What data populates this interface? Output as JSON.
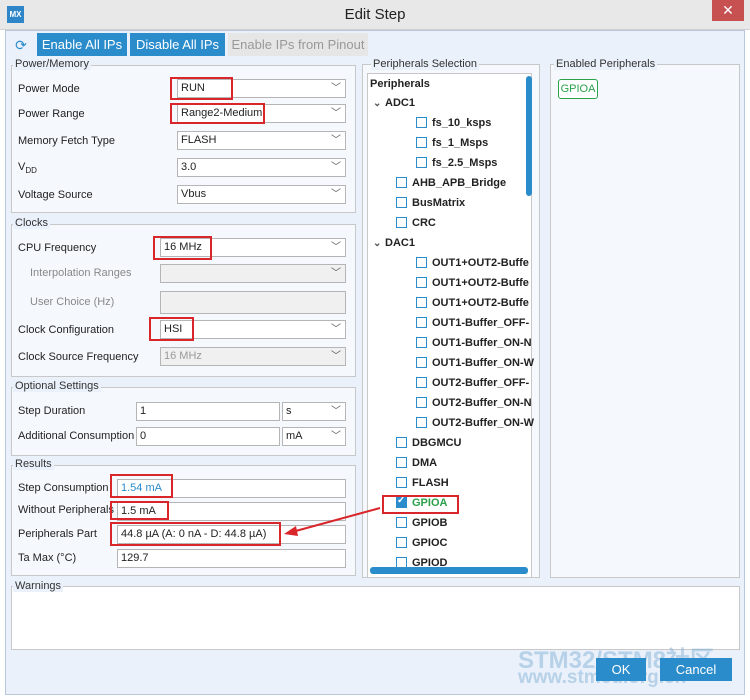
{
  "window": {
    "title": "Edit Step",
    "app_icon": "MX",
    "close_glyph": "✕"
  },
  "toolbar": {
    "refresh_icon": "refresh-icon",
    "enable_all": "Enable All IPs",
    "disable_all": "Disable All IPs",
    "enable_from_pinout": "Enable IPs from Pinout"
  },
  "power_memory": {
    "title": "Power/Memory",
    "power_mode": {
      "label": "Power Mode",
      "value": "RUN"
    },
    "power_range": {
      "label": "Power Range",
      "value": "Range2-Medium"
    },
    "memory_fetch": {
      "label": "Memory Fetch Type",
      "value": "FLASH"
    },
    "vdd": {
      "label": "V",
      "sub": "DD",
      "value": "3.0"
    },
    "voltage_source": {
      "label": "Voltage Source",
      "value": "Vbus"
    }
  },
  "clocks": {
    "title": "Clocks",
    "cpu_frequency": {
      "label": "CPU Frequency",
      "value": "16 MHz"
    },
    "interpolation_ranges": {
      "label": "Interpolation Ranges",
      "value": ""
    },
    "user_choice": {
      "label": "User Choice (Hz)",
      "value": ""
    },
    "clock_configuration": {
      "label": "Clock Configuration",
      "value": "HSI"
    },
    "clock_source_frequency": {
      "label": "Clock Source Frequency",
      "value": "16 MHz"
    }
  },
  "optional": {
    "title": "Optional Settings",
    "step_duration": {
      "label": "Step Duration",
      "value": "1",
      "unit": "s"
    },
    "additional_consumption": {
      "label": "Additional Consumption",
      "value": "0",
      "unit": "mA"
    }
  },
  "results": {
    "title": "Results",
    "step_consumption": {
      "label": "Step Consumption",
      "value": "1.54 mA"
    },
    "without_peripherals": {
      "label": "Without Peripherals",
      "value": "1.5 mA"
    },
    "peripherals_part": {
      "label": "Peripherals Part",
      "value": "44.8 µA  (A: 0 nA - D: 44.8 µA)"
    },
    "ta_max": {
      "label": "Ta Max (°C)",
      "value": "129.7"
    }
  },
  "peripherals_selection": {
    "title": "Peripherals Selection",
    "header": "Peripherals",
    "items": [
      {
        "label": "ADC1",
        "kind": "parent"
      },
      {
        "label": "fs_10_ksps",
        "kind": "child"
      },
      {
        "label": "fs_1_Msps",
        "kind": "child"
      },
      {
        "label": "fs_2.5_Msps",
        "kind": "child"
      },
      {
        "label": "AHB_APB_Bridge",
        "kind": "leaf"
      },
      {
        "label": "BusMatrix",
        "kind": "leaf"
      },
      {
        "label": "CRC",
        "kind": "leaf"
      },
      {
        "label": "DAC1",
        "kind": "parent"
      },
      {
        "label": "OUT1+OUT2-Buffe",
        "kind": "child"
      },
      {
        "label": "OUT1+OUT2-Buffe",
        "kind": "child"
      },
      {
        "label": "OUT1+OUT2-Buffe",
        "kind": "child"
      },
      {
        "label": "OUT1-Buffer_OFF-",
        "kind": "child"
      },
      {
        "label": "OUT1-Buffer_ON-N",
        "kind": "child"
      },
      {
        "label": "OUT1-Buffer_ON-W",
        "kind": "child"
      },
      {
        "label": "OUT2-Buffer_OFF-",
        "kind": "child"
      },
      {
        "label": "OUT2-Buffer_ON-N",
        "kind": "child"
      },
      {
        "label": "OUT2-Buffer_ON-W",
        "kind": "child"
      },
      {
        "label": "DBGMCU",
        "kind": "leaf"
      },
      {
        "label": "DMA",
        "kind": "leaf"
      },
      {
        "label": "FLASH",
        "kind": "leaf"
      },
      {
        "label": "GPIOA",
        "kind": "leaf",
        "checked": true
      },
      {
        "label": "GPIOB",
        "kind": "leaf"
      },
      {
        "label": "GPIOC",
        "kind": "leaf"
      },
      {
        "label": "GPIOD",
        "kind": "leaf"
      }
    ]
  },
  "enabled_peripherals": {
    "title": "Enabled Peripherals",
    "items": [
      "GPIOA"
    ]
  },
  "warnings": {
    "title": "Warnings"
  },
  "buttons": {
    "ok": "OK",
    "cancel": "Cancel"
  },
  "watermark": {
    "line1": "STM32/STM8社区",
    "line2": "www.stmcu.org.cn"
  },
  "colors": {
    "accent": "#2b8ccc",
    "highlight": "#d9262a",
    "enabled": "#2aa14a"
  }
}
